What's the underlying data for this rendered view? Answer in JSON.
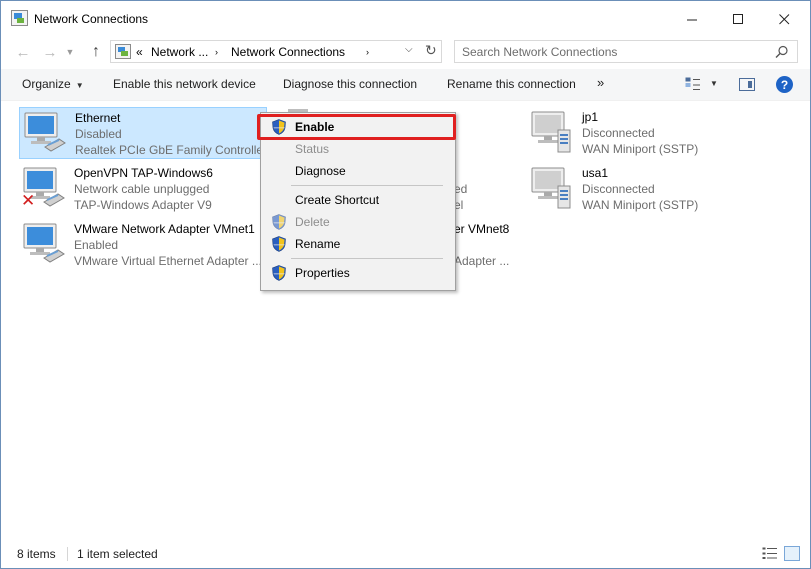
{
  "window": {
    "title": "Network Connections"
  },
  "nav": {
    "breadcrumb_overflow": "«",
    "breadcrumbs": [
      "Network ...",
      "Network Connections"
    ],
    "search_placeholder": "Search Network Connections"
  },
  "toolbar": {
    "organize": "Organize",
    "enable_device": "Enable this network device",
    "diagnose": "Diagnose this connection",
    "rename": "Rename this connection",
    "more": "»"
  },
  "items": [
    {
      "name": "Ethernet",
      "status": "Disabled",
      "adapter": "Realtek PCIe GbE Family Controller",
      "selected": true
    },
    {
      "name": "OpenVPN TAP-Windows6",
      "status": "Network cable unplugged",
      "adapter": "TAP-Windows Adapter V9",
      "error": true
    },
    {
      "name": "VMware Network Adapter VMnet1",
      "status": "Enabled",
      "adapter": "VMware Virtual Ethernet Adapter ..."
    },
    {
      "name": "jp1",
      "status": "Disconnected",
      "adapter": "WAN Miniport (SSTP)"
    },
    {
      "name": "usa1",
      "status": "Disconnected",
      "adapter": "WAN Miniport (SSTP)"
    }
  ],
  "occluded_fragments": {
    "status_2": "ed",
    "adapter_2": "el",
    "name_3": "er VMnet8",
    "adapter_3": "Adapter ..."
  },
  "context_menu": {
    "items": [
      {
        "label": "Enable",
        "shield": true,
        "default": true
      },
      {
        "label": "Status",
        "disabled": true
      },
      {
        "label": "Diagnose"
      },
      {
        "label": "Create Shortcut"
      },
      {
        "label": "Delete",
        "shield": true,
        "disabled": true
      },
      {
        "label": "Rename",
        "shield": true
      },
      {
        "label": "Properties",
        "shield": true
      }
    ]
  },
  "status_bar": {
    "count": "8 items",
    "selection": "1 item selected"
  },
  "colors": {
    "selection_bg": "#cce8ff",
    "highlight_border": "#e02020",
    "help_blue": "#1e63c6"
  }
}
